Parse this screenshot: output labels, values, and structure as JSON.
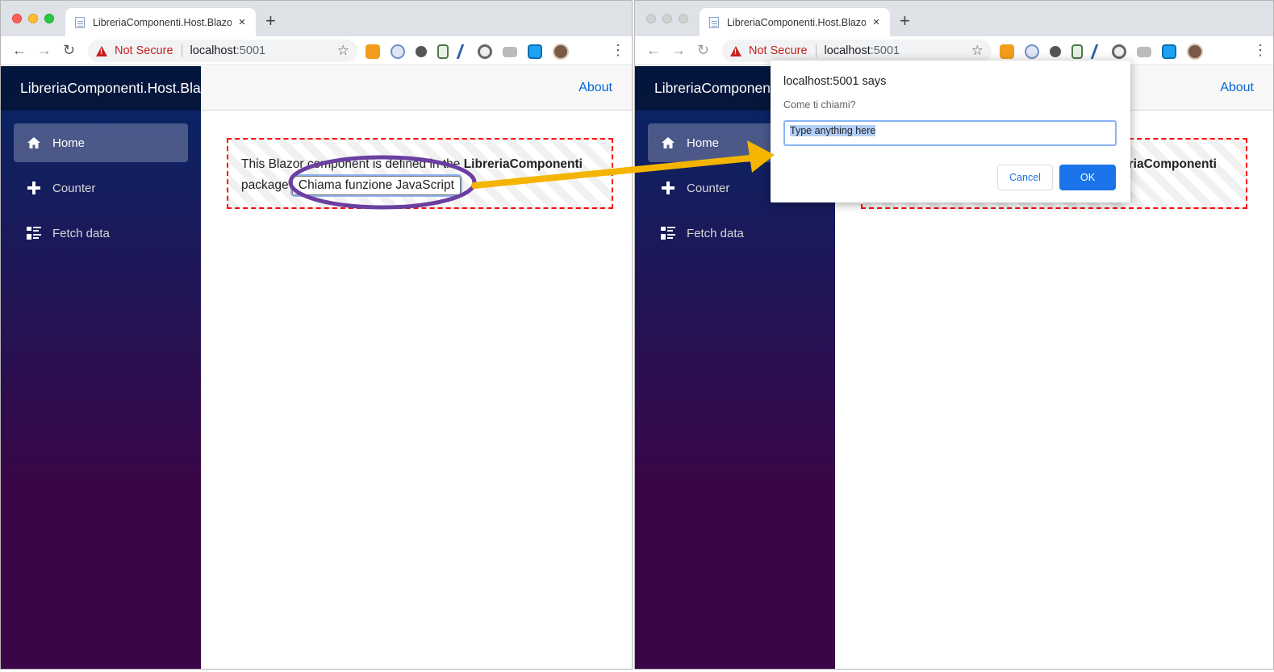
{
  "browser": {
    "tab_title": "LibreriaComponenti.Host.Blazor",
    "tab_close": "×",
    "new_tab": "+",
    "security_label": "Not Secure",
    "url_host": "localhost",
    "url_port": ":5001"
  },
  "app": {
    "brand": "LibreriaComponenti.Host.Blazor",
    "about_link": "About",
    "nav": [
      {
        "label": "Home",
        "icon": "home-icon"
      },
      {
        "label": "Counter",
        "icon": "plus-icon"
      },
      {
        "label": "Fetch data",
        "icon": "list-icon"
      }
    ],
    "component_text_pre": "This Blazor component is defined in the ",
    "component_package_name": "LibreriaComponenti",
    "component_text_post": " package.",
    "js_button_label": "Chiama funzione JavaScript"
  },
  "dialog": {
    "title": "localhost:5001 says",
    "message": "Come ti chiami?",
    "input_value": "Type anything here",
    "cancel_label": "Cancel",
    "ok_label": "OK"
  },
  "colors": {
    "annotation_arrow": "#f4b400",
    "annotation_ellipse": "#6b3fa0",
    "component_border": "#ff0000",
    "link": "#0366d6",
    "dialog_primary": "#1a73e8"
  }
}
